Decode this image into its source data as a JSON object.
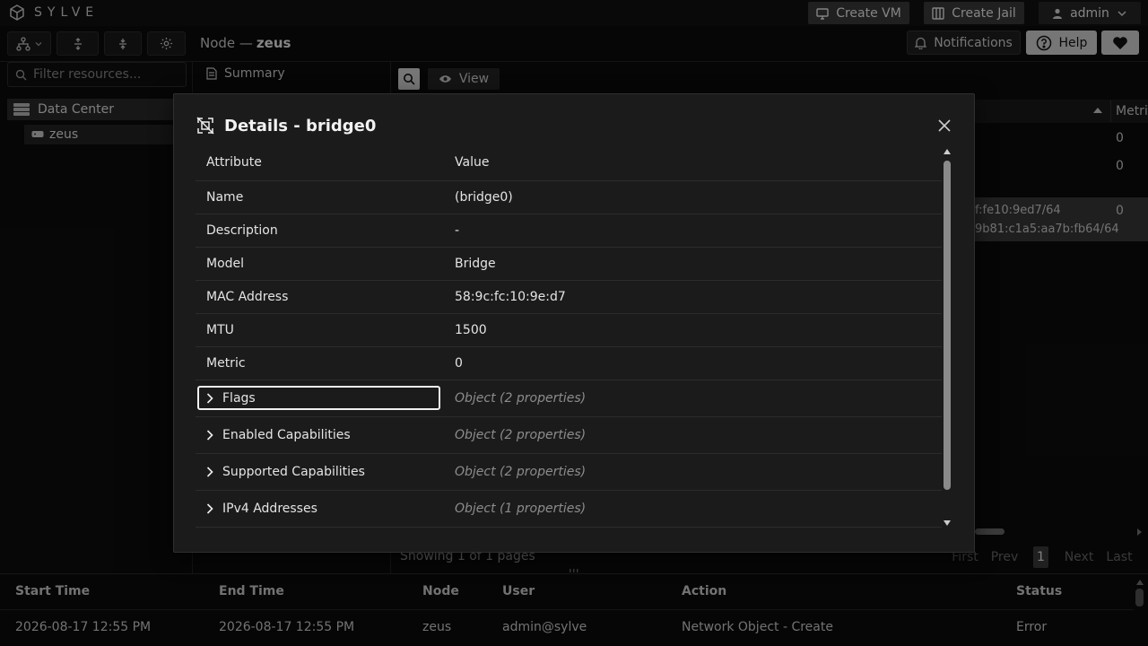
{
  "app": {
    "brand": "SYLVE",
    "create_vm_label": "Create VM",
    "create_jail_label": "Create Jail",
    "user_label": "admin"
  },
  "toolbar": {
    "node_prefix": "Node —",
    "node_name": "zeus",
    "notifications_label": "Notifications",
    "help_label": "Help"
  },
  "sidebar": {
    "filter_placeholder": "Filter resources...",
    "datacenter_label": "Data Center",
    "node_label": "zeus"
  },
  "main": {
    "summary_tab": "Summary",
    "view_label": "View",
    "metric_header": "Metri",
    "rows": [
      {
        "metric": "0"
      },
      {
        "metric": "0"
      },
      {
        "ipv6_1": "f:fe10:9ed7/64",
        "ipv6_2": "9b81:c1a5:aa7b:fb64/64",
        "metric": "0"
      }
    ],
    "showing_text": "Showing 1 of 1 pages",
    "pager": {
      "first": "First",
      "prev": "Prev",
      "current": "1",
      "next": "Next",
      "last": "Last"
    }
  },
  "tasks": {
    "headers": {
      "start": "Start Time",
      "end": "End Time",
      "node": "Node",
      "user": "User",
      "action": "Action",
      "status": "Status"
    },
    "row": {
      "start": "2026-08-17 12:55 PM",
      "end": "2026-08-17 12:55 PM",
      "node": "zeus",
      "user": "admin@sylve",
      "action": "Network Object - Create",
      "status": "Error"
    }
  },
  "modal": {
    "title": "Details - bridge0",
    "header_attribute": "Attribute",
    "header_value": "Value",
    "rows": [
      {
        "key": "Name",
        "value": "(bridge0)"
      },
      {
        "key": "Description",
        "value": "-"
      },
      {
        "key": "Model",
        "value": "Bridge"
      },
      {
        "key": "MAC Address",
        "value": "58:9c:fc:10:9e:d7"
      },
      {
        "key": "MTU",
        "value": "1500"
      },
      {
        "key": "Metric",
        "value": "0"
      }
    ],
    "objects": [
      {
        "key": "Flags",
        "value": "Object (2 properties)"
      },
      {
        "key": "Enabled Capabilities",
        "value": "Object (2 properties)"
      },
      {
        "key": "Supported Capabilities",
        "value": "Object (2 properties)"
      },
      {
        "key": "IPv4 Addresses",
        "value": "Object (1 properties)"
      }
    ]
  }
}
